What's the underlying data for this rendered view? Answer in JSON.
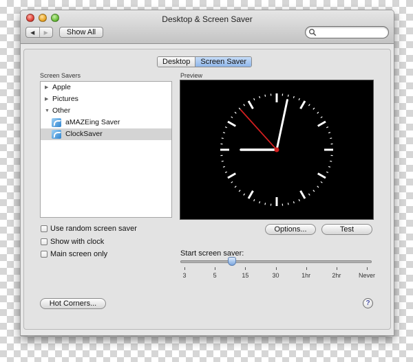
{
  "window": {
    "title": "Desktop & Screen Saver"
  },
  "toolbar": {
    "back_glyph": "◀",
    "forward_glyph": "▶",
    "show_all_label": "Show All",
    "search_value": "",
    "search_placeholder": ""
  },
  "tabs": [
    {
      "label": "Desktop",
      "selected": false
    },
    {
      "label": "Screen Saver",
      "selected": true
    }
  ],
  "screen_savers": {
    "heading": "Screen Savers",
    "items": [
      {
        "label": "Apple",
        "type": "group",
        "expanded": false,
        "disclosure": "▶"
      },
      {
        "label": "Pictures",
        "type": "group",
        "expanded": false,
        "disclosure": "▶"
      },
      {
        "label": "Other",
        "type": "group",
        "expanded": true,
        "disclosure": "▼"
      },
      {
        "label": "aMAZEing Saver",
        "type": "saver",
        "icon": "screen-saver-icon"
      },
      {
        "label": "ClockSaver",
        "type": "saver",
        "icon": "screen-saver-icon",
        "selected": true
      }
    ]
  },
  "preview": {
    "heading": "Preview",
    "clock": {
      "hour_hand_minutes_position": 45,
      "minute_hand_minutes_position": 2,
      "second_hand_minutes_position": 53
    }
  },
  "buttons": {
    "options_label": "Options...",
    "test_label": "Test",
    "hot_corners_label": "Hot Corners...",
    "help_label": "?"
  },
  "checkboxes": {
    "random": {
      "label": "Use random screen saver",
      "checked": false
    },
    "clock": {
      "label": "Show with clock",
      "checked": false
    },
    "main_screen": {
      "label": "Main screen only",
      "checked": false
    }
  },
  "start_saver": {
    "label": "Start screen saver:",
    "ticks": [
      "3",
      "5",
      "15",
      "30",
      "1hr",
      "2hr",
      "Never"
    ],
    "value_fraction": 0.26
  },
  "colors": {
    "accent": "#8fb6ea",
    "second_hand": "#d21f1f"
  }
}
